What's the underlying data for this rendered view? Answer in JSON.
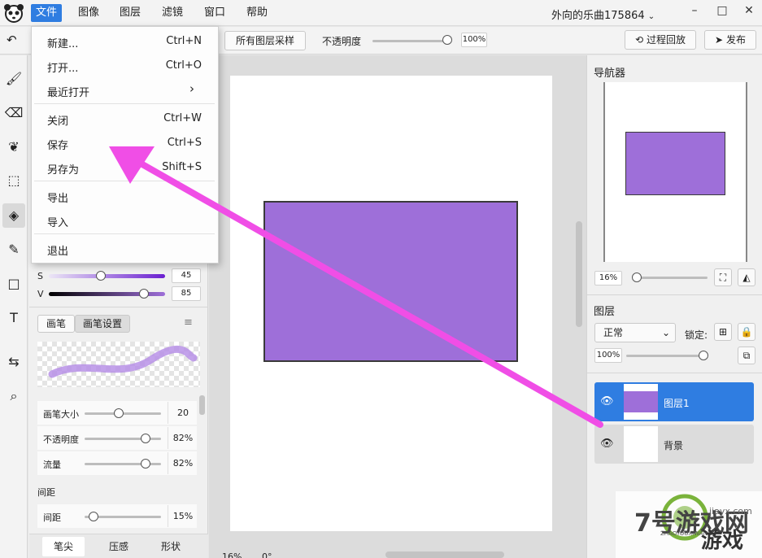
{
  "menubar": {
    "items": [
      "文件",
      "图像",
      "图层",
      "滤镜",
      "窗口",
      "帮助"
    ],
    "active_index": 0,
    "doc_title": "外向的乐曲175864"
  },
  "options": {
    "sample_all_label": "所有图层采样",
    "opacity_label": "不透明度",
    "opacity_value": "100%",
    "history_label": "过程回放",
    "publish_label": "发布"
  },
  "file_menu": {
    "items": [
      {
        "label": "新建...",
        "shortcut": "Ctrl+N"
      },
      {
        "label": "打开...",
        "shortcut": "Ctrl+O"
      },
      {
        "label": "最近打开",
        "shortcut": ""
      },
      {
        "label": "关闭",
        "shortcut": "Ctrl+W"
      },
      {
        "label": "保存",
        "shortcut": "Ctrl+S"
      },
      {
        "label": "另存为",
        "shortcut": "Shift+S"
      },
      {
        "label": "导出",
        "shortcut": ""
      },
      {
        "label": "导入",
        "shortcut": ""
      },
      {
        "label": "退出",
        "shortcut": ""
      }
    ]
  },
  "color": {
    "s_label": "S",
    "s_value": "45",
    "v_label": "V",
    "v_value": "85"
  },
  "brush": {
    "tab_brush": "画笔",
    "tab_settings": "画笔设置",
    "size_label": "画笔大小",
    "size_value": "20",
    "opacity_label": "不透明度",
    "opacity_value": "82%",
    "flow_label": "流量",
    "flow_value": "82%",
    "spacing_section": "间距",
    "spacing_label": "间距",
    "spacing_value": "15%",
    "bottom_tabs": [
      "笔尖",
      "压感",
      "形状"
    ]
  },
  "status": {
    "zoom": "16%",
    "angle": "0°"
  },
  "navigator": {
    "title": "导航器",
    "zoom": "16%"
  },
  "layers": {
    "title": "图层",
    "blend_mode": "正常",
    "lock_label": "锁定:",
    "opacity": "100%",
    "items": [
      {
        "name": "图层1",
        "selected": true
      },
      {
        "name": "背景",
        "selected": false
      }
    ]
  },
  "colors": {
    "accent": "#2f7de1",
    "shape_fill": "#9e6fd9",
    "arrow": "#f04ee6"
  },
  "watermark": {
    "text1": "7号游戏网",
    "text2": "ZHAOYOUXIWANG",
    "text3": "游戏",
    "site": "jiayx.com"
  }
}
